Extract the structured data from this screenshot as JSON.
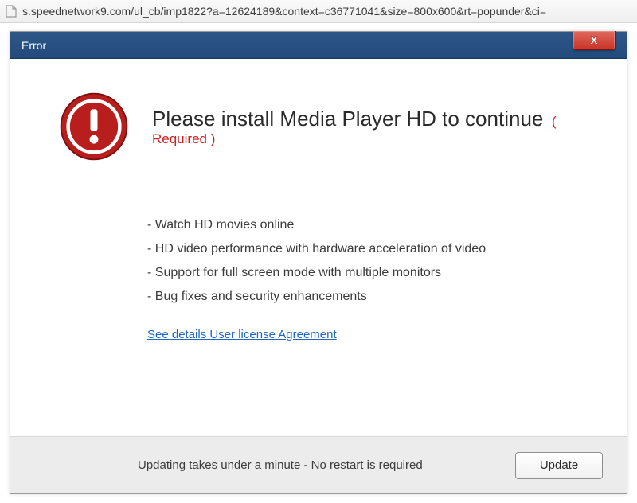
{
  "address_bar": {
    "url": "s.speednetwork9.com/ul_cb/imp1822?a=12624189&context=c36771041&size=800x600&rt=popunder&ci="
  },
  "dialog": {
    "title": "Error",
    "close_label": "X",
    "headline": "Please install Media Player HD to continue",
    "required_tag": "( Required )",
    "features": [
      "- Watch HD movies online",
      "- HD video performance with hardware acceleration of video",
      "- Support for full screen mode with multiple monitors",
      "- Bug fixes and security enhancements"
    ],
    "eula_link": "See details User license Agreement",
    "footer_text": "Updating takes under a minute - No restart is required",
    "update_button": "Update"
  }
}
